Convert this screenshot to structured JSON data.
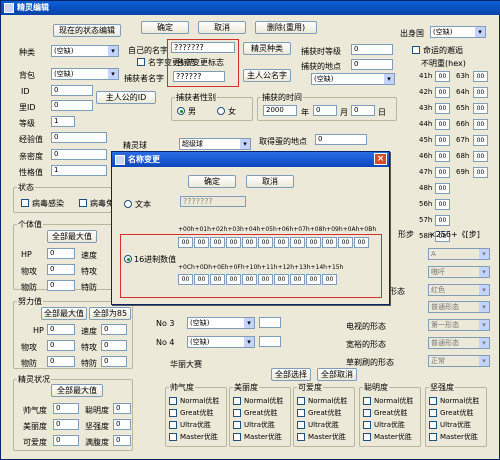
{
  "window": {
    "title": "精灵编辑"
  },
  "top": {
    "edit_current": "现在的状态编辑",
    "ok": "确定",
    "cancel": "取消",
    "delete": "删除(重用)",
    "appear_country": "出身国",
    "country_value": "(空缺)"
  },
  "left": {
    "type_label": "种类",
    "type_value": "(空缺)",
    "bag_label": "背包",
    "bag_value": "(空缺)",
    "id_label": "ID",
    "id_value": "0",
    "pid_label": "里ID",
    "pid_value": "0",
    "owner_id": "主人公的ID",
    "level_label": "等级",
    "level_value": "1",
    "exp_label": "经验值",
    "exp_value": "0",
    "intimacy_label": "亲密度",
    "intimacy_value": "0",
    "nature_label": "性格值",
    "nature_value": "1",
    "status_label": "状态",
    "poison": "病毒感染",
    "poison2": "病毒免",
    "indiv_label": "个体值",
    "all_max": "全部最大值",
    "hp": "HP",
    "speed": "速度",
    "atk": "物攻",
    "spatk": "特攻",
    "def": "物防",
    "spdef": "特防",
    "zero": "0",
    "effort_label": "努力值",
    "all_max2": "全部最大值",
    "all_to_85": "全部为85",
    "condition_label": "精灵状况",
    "all_max3": "全部最大值",
    "cool": "帅气度",
    "beauty": "美丽度",
    "cute": "可爱度",
    "smart": "聪明度",
    "tough": "坚强度",
    "luster": "满腹度"
  },
  "mid": {
    "nickname_label": "自己的名字",
    "nickname_value": "???????",
    "name_change": "名字变更标志",
    "name_change_text": "名字变更标志",
    "catcher_label": "捕获者名字",
    "catcher_value": "??????",
    "hero_name": "主人公名字",
    "sprite_name": "精灵种类",
    "catch_level_label": "捕获时等级",
    "catch_level_value": "0",
    "catch_place_label": "捕获的地点",
    "catch_place_value": "0",
    "catch_place_sel": "(空缺)",
    "catcher_sex": "捕获者性别",
    "male": "男",
    "female": "女",
    "catch_time": "捕获的时间",
    "year": "2000",
    "year_u": "年",
    "month": "0",
    "month_u": "月",
    "day": "0",
    "day_u": "日",
    "ball_label": "精灵球",
    "ball_value": "超级球",
    "obtain_place": "取得蛋的地点",
    "obtain_value": "0",
    "ribbon_label": "华丽大赛",
    "all_select": "全部选择",
    "all_cancel": "全部取消",
    "no3": "No 3",
    "no3_value": "(空缺)",
    "no4": "No 4",
    "no4_value": "(空缺)"
  },
  "right": {
    "fate": "命运的邂逅",
    "unknown_label": "不明重(hex)",
    "r41": "41h",
    "r42": "42h",
    "r43": "43h",
    "r44": "44h",
    "r45": "45h",
    "r46": "46h",
    "r47": "47h",
    "r48": "48h",
    "r56": "56h",
    "r57": "57h",
    "r58": "58h",
    "r63": "63h",
    "r64": "64h",
    "r65": "65h",
    "r66": "66h",
    "r67": "67h",
    "r68": "68h",
    "r69": "69h",
    "v00": "00",
    "form_step": "形步",
    "x256": "×256+《[步]",
    "form1": "A",
    "form2": "嗷吁",
    "form3": "红色",
    "form4": "普通形态",
    "form5": "第一形态",
    "form6": "普通形态",
    "form7": "正常",
    "shape_label": "形态",
    "robot": "电视的形态",
    "roto": "宽裕的形态",
    "grass": "草剃刷的形态"
  },
  "contest": {
    "cols": [
      "帅气度",
      "美丽度",
      "可爱度",
      "聪明度",
      "坚强度"
    ],
    "rows": [
      "Normal优胜",
      "Great优胜",
      "Ultra优胜",
      "Master优胜"
    ]
  },
  "dialog": {
    "title": "名称变更",
    "ok": "确定",
    "cancel": "取消",
    "text_label": "文本",
    "text_value": "???????",
    "hex_label": "16进制数值",
    "hex_header1": "+00h+01h+02h+03h+04h+05h+06h+07h+08h+09h+0Ah+0Bh",
    "hex_header2": "+0Ch+0Dh+0Eh+0Fh+10h+11h+12h+13h+14h+15h",
    "hex_row1": [
      "00",
      "00",
      "00",
      "00",
      "00",
      "00",
      "00",
      "00",
      "00",
      "00",
      "00",
      "00"
    ],
    "hex_row2": [
      "00",
      "00",
      "00",
      "00",
      "00",
      "00",
      "00",
      "00",
      "00",
      "00"
    ]
  }
}
